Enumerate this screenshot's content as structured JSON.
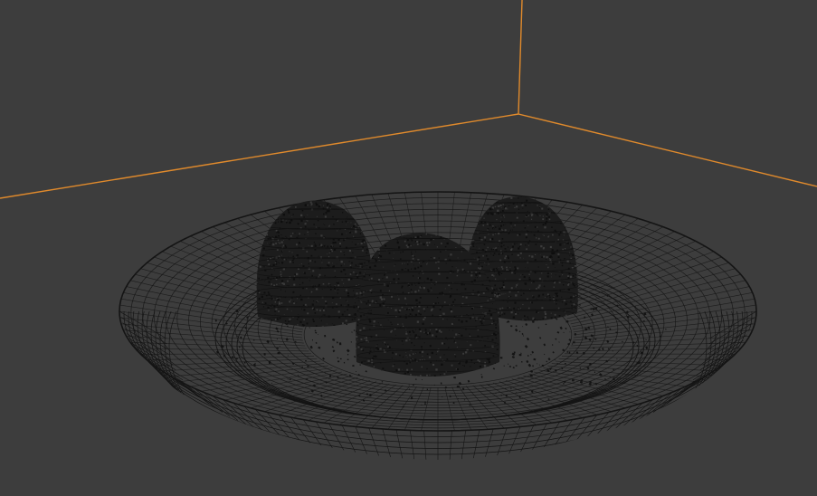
{
  "viewport": {
    "background_color": "#3d3d3d",
    "shading_mode": "wireframe"
  },
  "scene": {
    "room_edge_color": "#e08a2c",
    "wire_color": "#141414",
    "objects": [
      {
        "name": "plate",
        "type": "mesh"
      },
      {
        "name": "dome-left",
        "type": "mesh"
      },
      {
        "name": "dome-right",
        "type": "mesh"
      },
      {
        "name": "dome-front",
        "type": "mesh"
      },
      {
        "name": "crumbs",
        "type": "particles"
      }
    ]
  }
}
